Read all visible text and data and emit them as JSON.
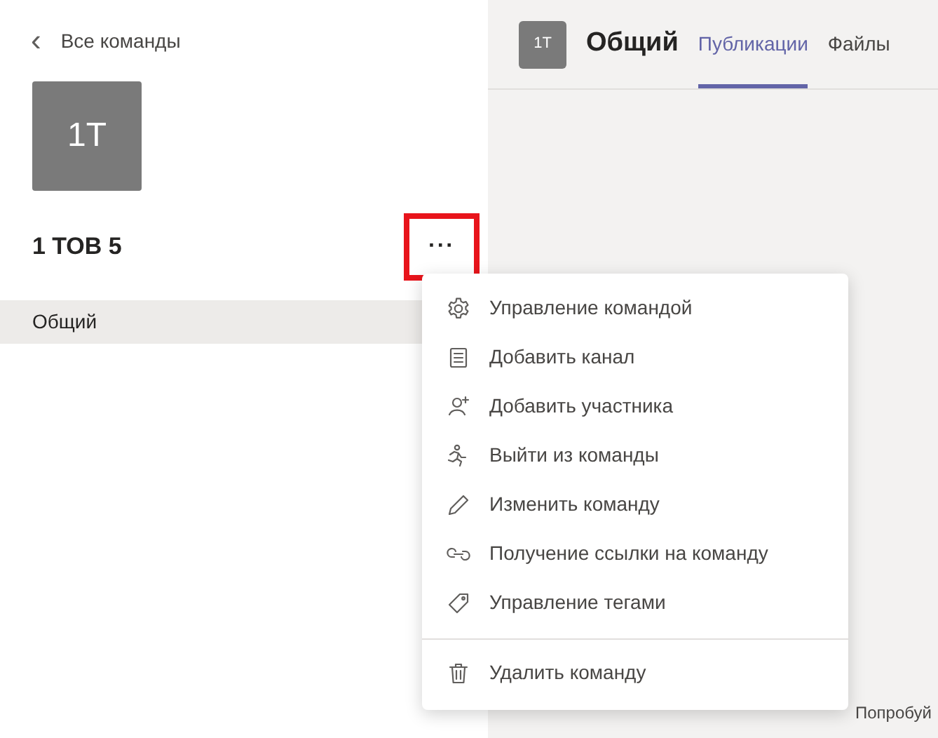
{
  "sidebar": {
    "back_link": {
      "icon": "‹",
      "label": "Все команды"
    },
    "team_avatar": "1T",
    "team_name": "1 ТОВ 5",
    "more_button": {
      "label": "···",
      "highlighted": true
    },
    "channels": [
      {
        "name": "Общий",
        "selected": true
      }
    ]
  },
  "header": {
    "avatar": "1T",
    "title": "Общий",
    "tabs": [
      {
        "label": "Публикации",
        "selected": true
      },
      {
        "label": "Файлы",
        "selected": false
      }
    ]
  },
  "menu": {
    "items": [
      {
        "kind": "item",
        "label": "Управление командой"
      },
      {
        "kind": "item",
        "label": "Добавить канал"
      },
      {
        "kind": "item",
        "label": "Добавить участника"
      },
      {
        "kind": "item",
        "label": "Выйти из команды"
      },
      {
        "kind": "item",
        "label": "Изменить команду"
      },
      {
        "kind": "item",
        "label": "Получение ссылки на команду"
      },
      {
        "kind": "item",
        "label": "Управление тегами"
      },
      {
        "kind": "divider"
      },
      {
        "kind": "item",
        "label": "Удалить команду"
      }
    ]
  },
  "footer_text": "Попробуй"
}
